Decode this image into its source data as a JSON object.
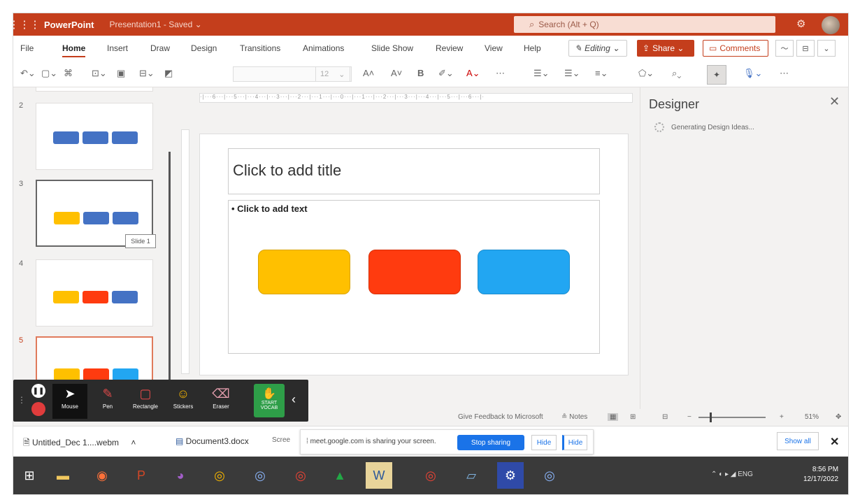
{
  "titlebar": {
    "app_name": "PowerPoint",
    "doc_title": "Presentation1 - Saved ⌄",
    "search_placeholder": "Search (Alt + Q)"
  },
  "menu": {
    "items": [
      "File",
      "Home",
      "Insert",
      "Draw",
      "Design",
      "Transitions",
      "Animations",
      "Slide Show",
      "Review",
      "View",
      "Help"
    ],
    "editing_label": "Editing ⌄",
    "share_label": "Share ⌄",
    "comments_label": "Comments"
  },
  "toolbar": {
    "font_size": "12"
  },
  "thumbnails": [
    {
      "number": "2"
    },
    {
      "number": "3"
    },
    {
      "number": "4"
    },
    {
      "number": "5"
    }
  ],
  "tooltip": "Slide 1",
  "slide": {
    "title_placeholder": "Click to add title",
    "body_placeholder": "• Click to add text",
    "shape_colors": [
      "#ffc000",
      "#ff3b0f",
      "#22a6f2"
    ]
  },
  "designer": {
    "title": "Designer",
    "status": "Generating Design Ideas..."
  },
  "statusbar": {
    "feedback": "Give Feedback to Microsoft",
    "notes": "Notes",
    "zoom": "51%"
  },
  "annotation_tools": [
    {
      "label": "Mouse"
    },
    {
      "label": "Pen"
    },
    {
      "label": "Rectangle"
    },
    {
      "label": "Stickers"
    },
    {
      "label": "Eraser"
    }
  ],
  "record_label": "START VOCAB",
  "downloads": {
    "file1": "Untitled_Dec 1....webm",
    "file2": "Document3.docx",
    "notice_prefix": "Scree",
    "notice_text": "meet.google.com is sharing your screen.",
    "stop_sharing": "Stop sharing",
    "hide": "Hide",
    "show_all": "Show all"
  },
  "taskbar": {
    "lang": "ENG",
    "time": "8:56 PM",
    "date": "12/17/2022"
  },
  "colors": {
    "accent": "#c43e1c",
    "thumb_blue": "#4472c4",
    "thumb_yellow": "#ffc000",
    "thumb_red": "#ff3b0f",
    "thumb_cyan": "#22a6f2"
  }
}
